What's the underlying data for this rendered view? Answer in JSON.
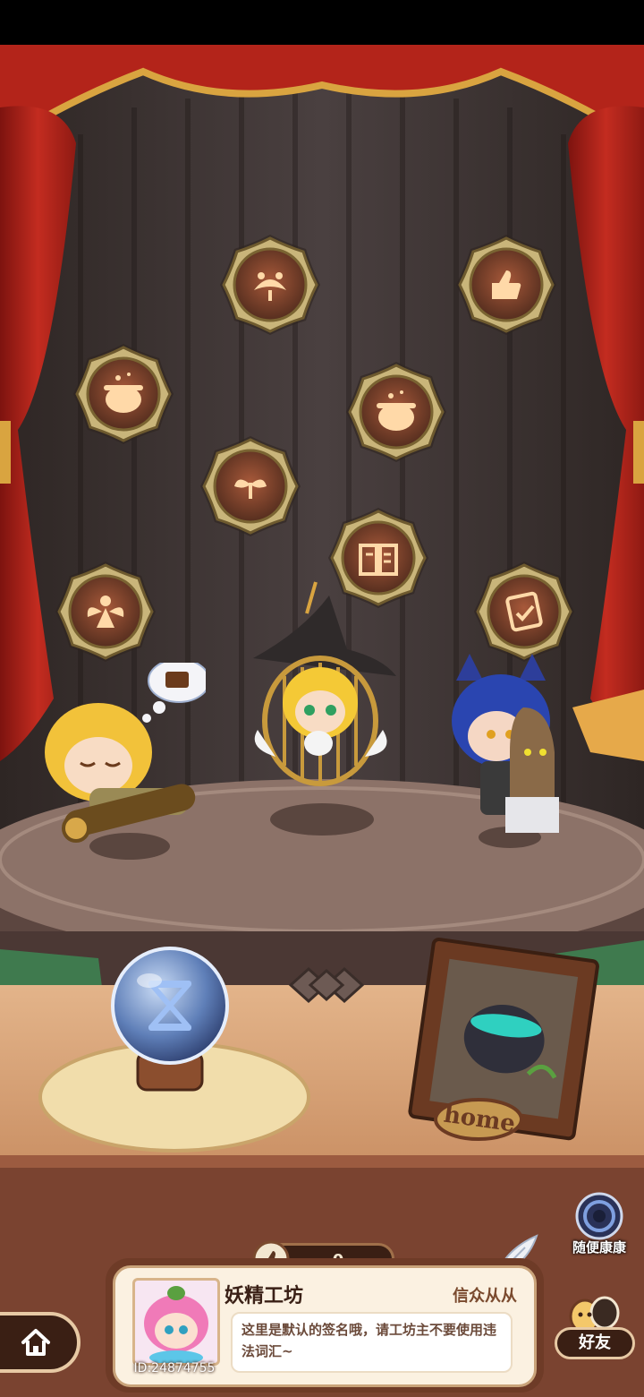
{
  "badges": [
    {
      "id": "leaf-mask",
      "icon": "leaf-mask-icon"
    },
    {
      "id": "thumbs-up",
      "icon": "thumbs-up-icon"
    },
    {
      "id": "cauldron-1",
      "icon": "cauldron-icon"
    },
    {
      "id": "cauldron-2",
      "icon": "cauldron-icon"
    },
    {
      "id": "sprout-mask",
      "icon": "sprout-mask-icon"
    },
    {
      "id": "spellbook",
      "icon": "spellbook-icon"
    },
    {
      "id": "fairy",
      "icon": "fairy-icon"
    },
    {
      "id": "scroll-check",
      "icon": "scroll-check-icon"
    }
  ],
  "photo_frame": {
    "label": "home"
  },
  "likes": {
    "count": "0"
  },
  "random_visit": {
    "label": "随便康康"
  },
  "profile": {
    "name": "妖精工坊",
    "rank": "信众从从",
    "signature": "这里是默认的签名哦，请工坊主不要使用违法词汇~",
    "user_id": "ID:24874755"
  },
  "friends": {
    "label": "好友"
  },
  "colors": {
    "curtain": "#b8241b",
    "stage": "#8a6e62",
    "badge_ring": "#c9b57a",
    "badge_face": "#6b3b28"
  }
}
